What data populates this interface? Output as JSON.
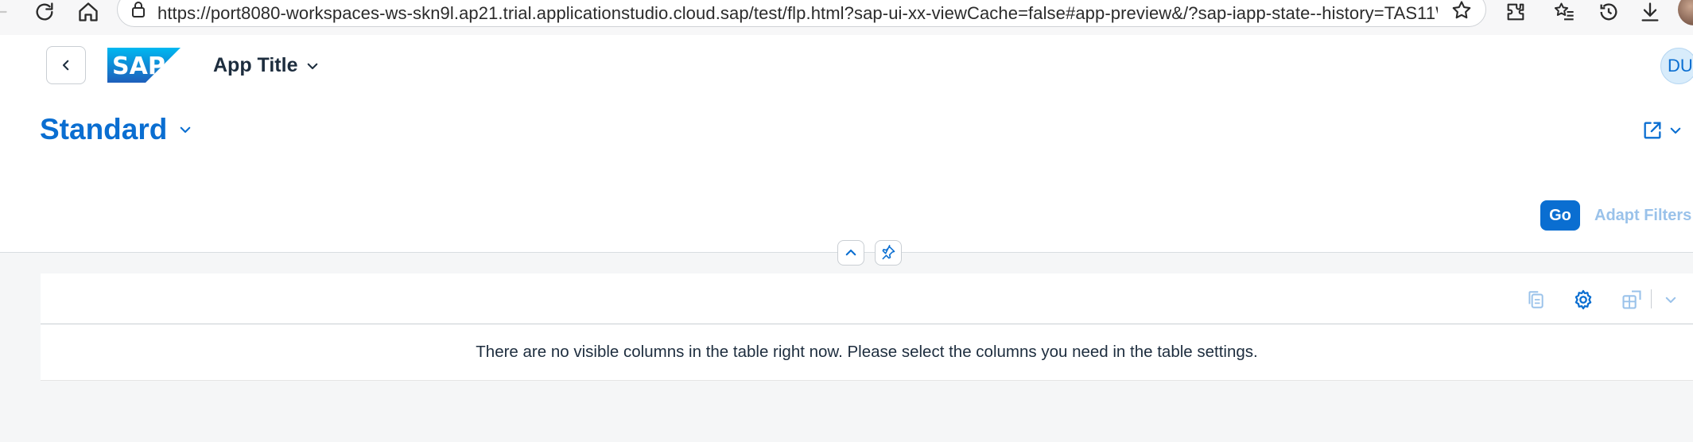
{
  "browser": {
    "url": "https://port8080-workspaces-ws-skn9l.ap21.trial.applicationstudio.cloud.sap/test/flp.html?sap-ui-xx-viewCache=false#app-preview&/?sap-iapp-state--history=TAS11WVKX..."
  },
  "shell": {
    "logo_text": "SAP",
    "app_title": "App Title",
    "user_initials": "DU"
  },
  "page_header": {
    "variant_title": "Standard",
    "go_label": "Go",
    "adapt_filters_label": "Adapt Filters"
  },
  "table": {
    "no_data_text": "There are no visible columns in the table right now. Please select the columns you need in the table settings."
  },
  "colors": {
    "accent": "#0a6ed1",
    "disabled_link": "#9ac2ea",
    "background": "#f5f6f7"
  }
}
